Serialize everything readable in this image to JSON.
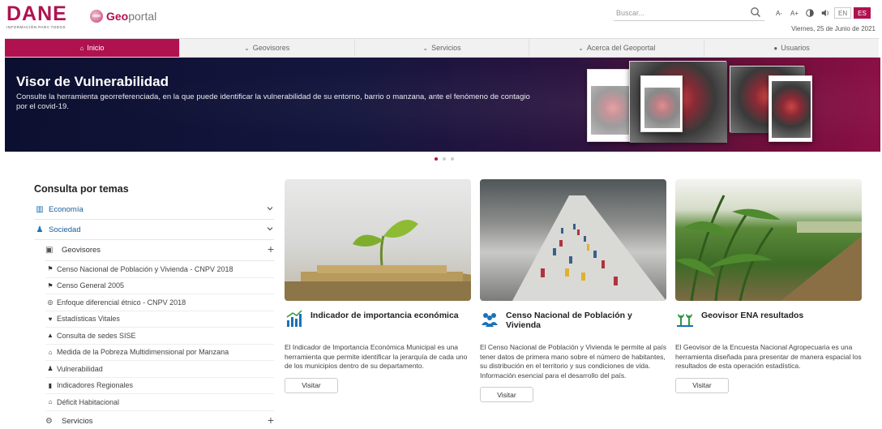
{
  "header": {
    "logo_text": "DANE",
    "logo_tagline": "INFORMACIÓN PARA TODOS",
    "geoportal_prefix": "Geo",
    "geoportal_suffix": "portal",
    "search_placeholder": "Buscar...",
    "tools": [
      "A-",
      "A+"
    ],
    "languages": [
      "EN",
      "ES"
    ],
    "active_language": "ES",
    "date": "Viernes, 25 de Junio de 2021"
  },
  "nav": {
    "items": [
      {
        "label": "Inicio",
        "icon": "home-icon",
        "active": true
      },
      {
        "label": "Geovisores",
        "icon": "chevron-down-icon"
      },
      {
        "label": "Servicios",
        "icon": "chevron-down-icon"
      },
      {
        "label": "Acerca del Geoportal",
        "icon": "chevron-down-icon"
      },
      {
        "label": "Usuarios",
        "icon": "user-icon"
      }
    ]
  },
  "banner": {
    "title": "Visor de Vulnerabilidad",
    "text": "Consulte la herramienta georreferenciada, en la que puede identificar la vulnerabilidad de su entorno, barrio o manzana, ante el fenómeno de contagio por el covid-19.",
    "slide_count": 3,
    "active_slide": 1
  },
  "themes": {
    "title": "Consulta por temas",
    "categories": [
      {
        "label": "Economía",
        "icon": "chart-icon"
      },
      {
        "label": "Sociedad",
        "icon": "people-icon"
      }
    ],
    "geovisores_label": "Geovisores",
    "items": [
      {
        "label": "Censo Nacional de Población y Vivienda - CNPV 2018",
        "icon": "pin-icon"
      },
      {
        "label": "Censo General 2005",
        "icon": "pin-icon"
      },
      {
        "label": "Enfoque diferencial étnico - CNPV 2018",
        "icon": "globe-icon"
      },
      {
        "label": "Estadísticas Vitales",
        "icon": "heart-icon"
      },
      {
        "label": "Consulta de sedes SISE",
        "icon": "building-icon"
      },
      {
        "label": "Medida de la Pobreza Multidimensional por Manzana",
        "icon": "house-icon"
      },
      {
        "label": "Vulnerabilidad",
        "icon": "people-icon"
      },
      {
        "label": "Indicadores Regionales",
        "icon": "bars-icon"
      },
      {
        "label": "Déficit Habitacional",
        "icon": "house-icon"
      }
    ],
    "servicios_label": "Servicios"
  },
  "cards": [
    {
      "title": "Indicador de importancia económica",
      "description": "El Indicador de Importancia Económica Municipal es una herramienta que permite identificar la jerarquía de cada uno de los municipios dentro de su departamento.",
      "button": "Visitar",
      "icon": "bar-chart-icon"
    },
    {
      "title": "Censo Nacional de Población y Vivienda",
      "description": "El Censo Nacional de Población y Vivienda le permite al país tener datos de primera mano sobre el número de habitantes, su distribución en el territorio y sus condiciones de vida. Información esencial para el desarrollo del país.",
      "button": "Visitar",
      "icon": "people-icon"
    },
    {
      "title": "Geovisor ENA resultados",
      "description": "El Geovisor de la Encuesta Nacional Agropecuaria es una herramienta diseñada para presentar de manera espacial los resultados de esta operación estadística.",
      "button": "Visitar",
      "icon": "plant-icon"
    }
  ],
  "colors": {
    "brand": "#b0124f",
    "link": "#1a5b9a",
    "icon_blue": "#1a72b8",
    "icon_green": "#2e9b3f"
  }
}
